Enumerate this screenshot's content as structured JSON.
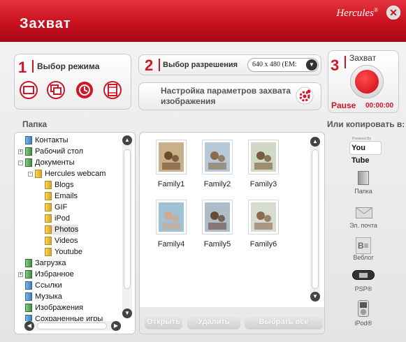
{
  "window": {
    "title": "Захват",
    "brand": "Hercules",
    "close_icon": "close-icon"
  },
  "mode": {
    "number": "1",
    "label": "Выбор режима",
    "buttons": [
      "single-frame-icon",
      "multi-frame-icon",
      "timer-icon",
      "video-icon"
    ]
  },
  "resolution": {
    "number": "2",
    "label": "Выбор разрешения",
    "value": "640 x 480 (EM:",
    "settings_label_line1": "Настройка параметров захвата",
    "settings_label_line2": "изображения"
  },
  "capture": {
    "number": "3",
    "label": "Захват",
    "pause_label": "Pause",
    "timer": "00:00:00"
  },
  "sections": {
    "folder": "Папка",
    "copy_to": "Или копировать в:"
  },
  "tree": [
    {
      "label": "Контакты",
      "indent": 1,
      "icon": "blue",
      "expander": ""
    },
    {
      "label": "Рабочий стол",
      "indent": 1,
      "icon": "green",
      "expander": "+"
    },
    {
      "label": "Документы",
      "indent": 1,
      "icon": "green",
      "expander": "-"
    },
    {
      "label": "Hercules webcam",
      "indent": 2,
      "icon": "folder",
      "expander": "-"
    },
    {
      "label": "Blogs",
      "indent": 3,
      "icon": "folder",
      "expander": ""
    },
    {
      "label": "Emails",
      "indent": 3,
      "icon": "folder",
      "expander": ""
    },
    {
      "label": "GIF",
      "indent": 3,
      "icon": "folder",
      "expander": ""
    },
    {
      "label": "iPod",
      "indent": 3,
      "icon": "folder",
      "expander": ""
    },
    {
      "label": "Photos",
      "indent": 3,
      "icon": "folder",
      "expander": "",
      "selected": true
    },
    {
      "label": "Videos",
      "indent": 3,
      "icon": "folder",
      "expander": ""
    },
    {
      "label": "Youtube",
      "indent": 3,
      "icon": "folder",
      "expander": ""
    },
    {
      "label": "Загрузка",
      "indent": 1,
      "icon": "green",
      "expander": ""
    },
    {
      "label": "Избранное",
      "indent": 1,
      "icon": "green",
      "expander": "+"
    },
    {
      "label": "Ссылки",
      "indent": 1,
      "icon": "blue",
      "expander": ""
    },
    {
      "label": "Музыка",
      "indent": 1,
      "icon": "blue",
      "expander": ""
    },
    {
      "label": "Изображения",
      "indent": 1,
      "icon": "green",
      "expander": ""
    },
    {
      "label": "Сохраненные игры",
      "indent": 1,
      "icon": "blue",
      "expander": ""
    }
  ],
  "photos": [
    "Family1",
    "Family2",
    "Family3",
    "Family4",
    "Family5",
    "Family6"
  ],
  "actions": {
    "open": "Открыть",
    "delete": "Удалить",
    "select_all": "Выбрать все"
  },
  "share": {
    "youtube": "You Tube",
    "folder": "Папка",
    "email": "Эл. почта",
    "blog": "Веблог",
    "psp": "PSP®",
    "ipod": "iPod®"
  },
  "colors": {
    "accent": "#d01626",
    "titlebar": "#c8101e"
  }
}
